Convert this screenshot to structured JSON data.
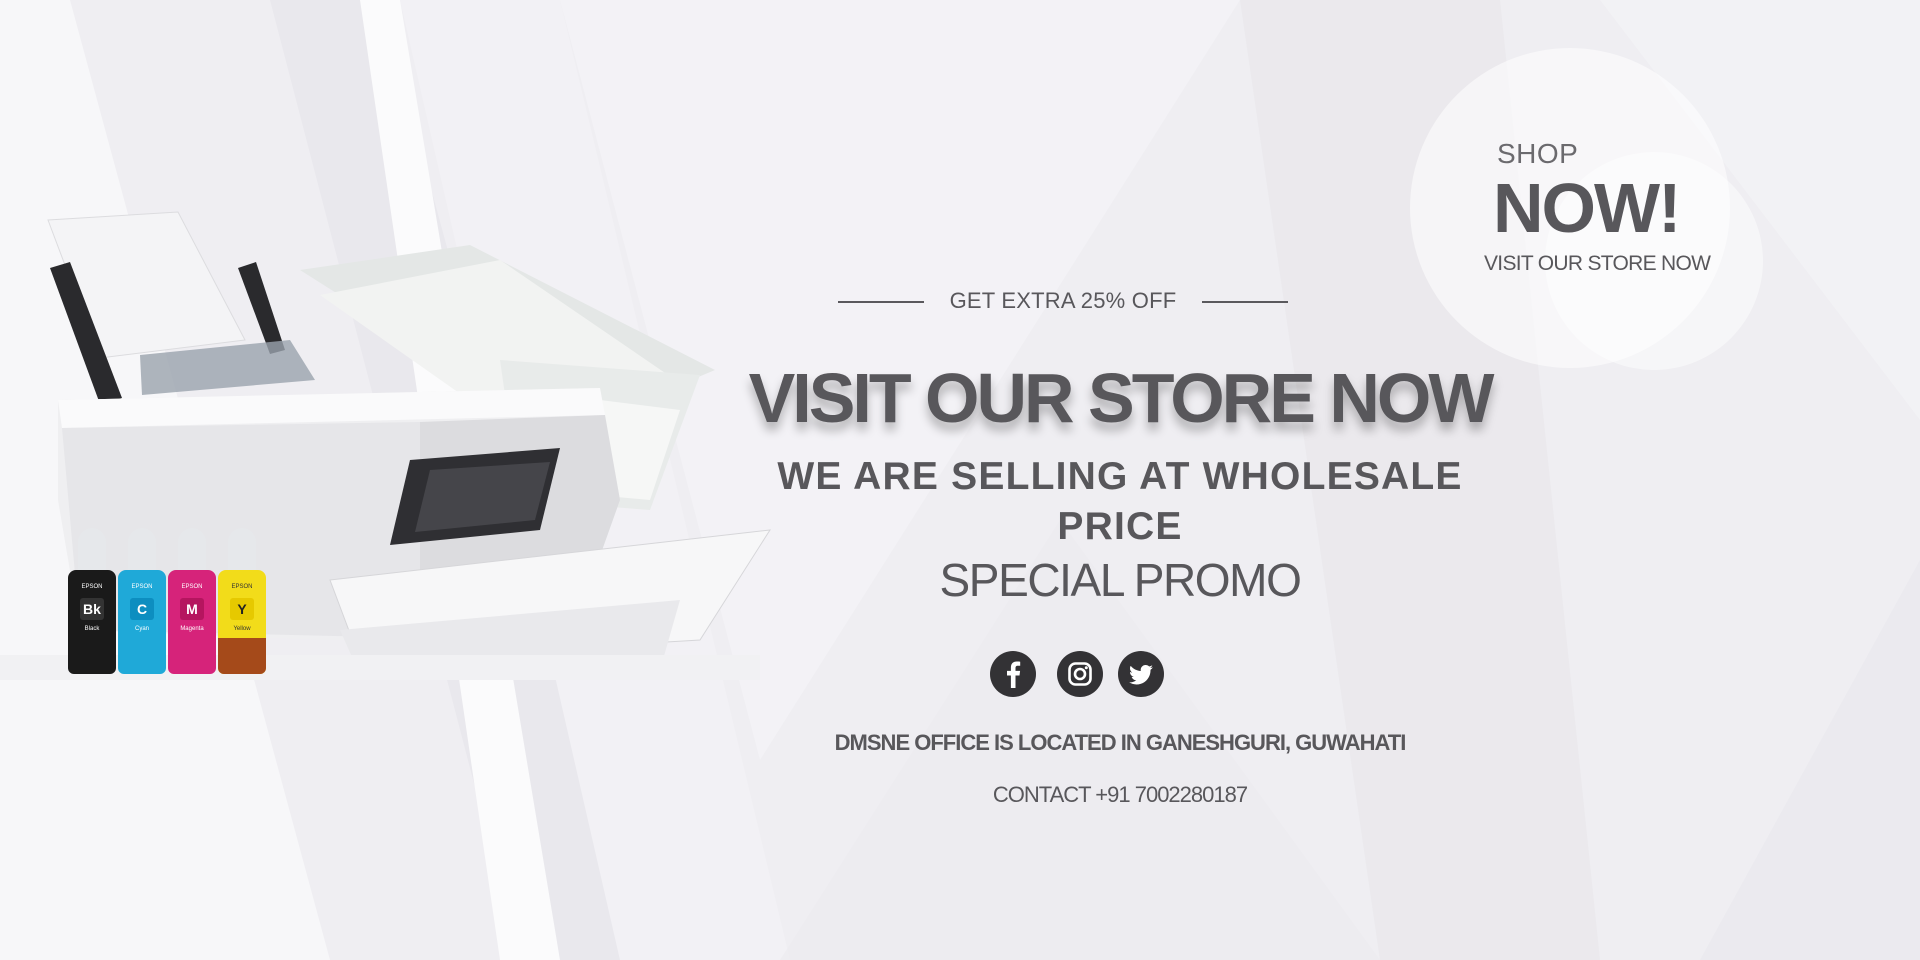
{
  "badge": {
    "shop": "SHOP",
    "now": "NOW!",
    "sub": "VISIT  OUR STORE NOW"
  },
  "offer": {
    "text": "GET EXTRA 25% OFF"
  },
  "headline": "VISIT OUR STORE NOW",
  "subline": "WE ARE SELLING AT WHOLESALE PRICE",
  "promo": "SPECIAL PROMO",
  "social": [
    {
      "name": "facebook",
      "icon": "facebook-icon"
    },
    {
      "name": "instagram",
      "icon": "instagram-icon"
    },
    {
      "name": "twitter",
      "icon": "twitter-icon"
    }
  ],
  "office": "DMSNE OFFICE IS LOCATED IN GANESHGURI, GUWAHATI",
  "contact": "CONTACT +91 7002280187",
  "ink_bottles": [
    {
      "brand": "EPSON",
      "code": "Bk",
      "label": "Black",
      "color": "#1a1a1a"
    },
    {
      "brand": "EPSON",
      "code": "C",
      "label": "Cyan",
      "color": "#1fa9d8"
    },
    {
      "brand": "EPSON",
      "code": "M",
      "label": "Magenta",
      "color": "#d6237a"
    },
    {
      "brand": "EPSON",
      "code": "Y",
      "label": "Yellow",
      "color": "#f2dc1a"
    }
  ],
  "colors": {
    "text": "#58575b",
    "background": "#f0eff3",
    "icon": "#333235"
  }
}
